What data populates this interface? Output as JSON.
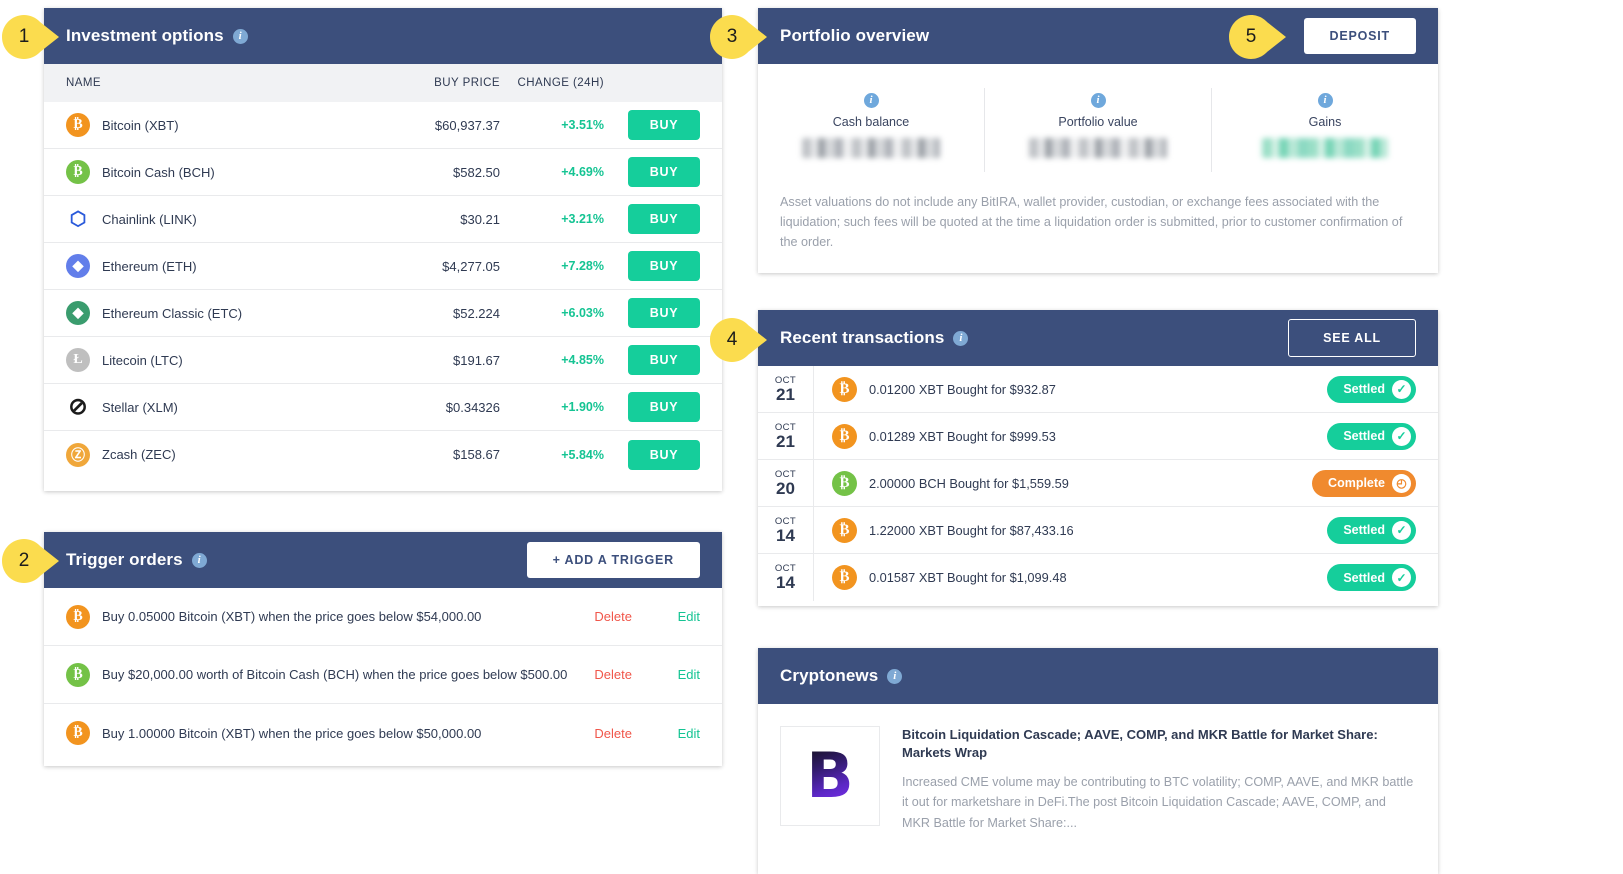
{
  "investment": {
    "title": "Investment options",
    "columns": {
      "name": "NAME",
      "price": "BUY PRICE",
      "change": "CHANGE (24H)"
    },
    "buy_label": "BUY",
    "rows": [
      {
        "name": "Bitcoin (XBT)",
        "price": "$60,937.37",
        "change": "+3.51%",
        "icon": "bitcoin-icon",
        "color": "#f2941f",
        "glyph": "₿"
      },
      {
        "name": "Bitcoin Cash (BCH)",
        "price": "$582.50",
        "change": "+4.69%",
        "icon": "bitcoin-cash-icon",
        "color": "#74c247",
        "glyph": "₿"
      },
      {
        "name": "Chainlink (LINK)",
        "price": "$30.21",
        "change": "+3.21%",
        "icon": "chainlink-icon",
        "color": "#2a5ada",
        "glyph": "⬡"
      },
      {
        "name": "Ethereum (ETH)",
        "price": "$4,277.05",
        "change": "+7.28%",
        "icon": "ethereum-icon",
        "color": "#627eea",
        "glyph": "◆"
      },
      {
        "name": "Ethereum Classic (ETC)",
        "price": "$52.224",
        "change": "+6.03%",
        "icon": "ethereum-classic-icon",
        "color": "#3a9c6e",
        "glyph": "◆"
      },
      {
        "name": "Litecoin (LTC)",
        "price": "$191.67",
        "change": "+4.85%",
        "icon": "litecoin-icon",
        "color": "#bfbfbf",
        "glyph": "Ł"
      },
      {
        "name": "Stellar (XLM)",
        "price": "$0.34326",
        "change": "+1.90%",
        "icon": "stellar-icon",
        "color": "#ffffff",
        "glyph": "⊘"
      },
      {
        "name": "Zcash (ZEC)",
        "price": "$158.67",
        "change": "+5.84%",
        "icon": "zcash-icon",
        "color": "#f0a73a",
        "glyph": "Ⓩ"
      }
    ]
  },
  "triggers": {
    "title": "Trigger orders",
    "add_label": "+ ADD A TRIGGER",
    "delete_label": "Delete",
    "edit_label": "Edit",
    "rows": [
      {
        "text": "Buy 0.05000 Bitcoin (XBT) when the price goes below $54,000.00",
        "icon": "bitcoin-icon",
        "color": "#f2941f",
        "glyph": "₿"
      },
      {
        "text": "Buy $20,000.00 worth of Bitcoin Cash (BCH) when the price goes below $500.00",
        "icon": "bitcoin-cash-icon",
        "color": "#74c247",
        "glyph": "₿"
      },
      {
        "text": "Buy 1.00000 Bitcoin (XBT) when the price goes below $50,000.00",
        "icon": "bitcoin-icon",
        "color": "#f2941f",
        "glyph": "₿"
      }
    ]
  },
  "portfolio": {
    "title": "Portfolio overview",
    "deposit_label": "DEPOSIT",
    "stats": [
      {
        "label": "Cash balance",
        "value": "",
        "redaction": "gray"
      },
      {
        "label": "Portfolio value",
        "value": "",
        "redaction": "gray"
      },
      {
        "label": "Gains",
        "value": "",
        "redaction": "green"
      }
    ],
    "disclaimer": "Asset valuations do not include any BitIRA, wallet provider, custodian, or exchange fees associated with the liquidation; such fees will be quoted at the time a liquidation order is submitted, prior to customer confirmation of the order."
  },
  "transactions": {
    "title": "Recent transactions",
    "see_all_label": "SEE ALL",
    "rows": [
      {
        "month": "OCT",
        "day": "21",
        "text": "0.01200 XBT Bought for $932.87",
        "status": "Settled",
        "status_type": "settled",
        "icon": "bitcoin-icon",
        "color": "#f2941f",
        "glyph": "₿"
      },
      {
        "month": "OCT",
        "day": "21",
        "text": "0.01289 XBT Bought for $999.53",
        "status": "Settled",
        "status_type": "settled",
        "icon": "bitcoin-icon",
        "color": "#f2941f",
        "glyph": "₿"
      },
      {
        "month": "OCT",
        "day": "20",
        "text": "2.00000 BCH Bought for $1,559.59",
        "status": "Complete",
        "status_type": "complete",
        "icon": "bitcoin-cash-icon",
        "color": "#74c247",
        "glyph": "₿"
      },
      {
        "month": "OCT",
        "day": "14",
        "text": "1.22000 XBT Bought for $87,433.16",
        "status": "Settled",
        "status_type": "settled",
        "icon": "bitcoin-icon",
        "color": "#f2941f",
        "glyph": "₿"
      },
      {
        "month": "OCT",
        "day": "14",
        "text": "0.01587 XBT Bought for $1,099.48",
        "status": "Settled",
        "status_type": "settled",
        "icon": "bitcoin-icon",
        "color": "#f2941f",
        "glyph": "₿"
      }
    ]
  },
  "news": {
    "title": "Cryptonews",
    "items": [
      {
        "logo": "B",
        "title": "Bitcoin Liquidation Cascade; AAVE, COMP, and MKR Battle for Market Share: Markets Wrap",
        "description": "Increased CME volume may be contributing to BTC volatility; COMP, AAVE, and MKR battle it out for marketshare in DeFi.The post Bitcoin Liquidation Cascade; AAVE, COMP, and MKR Battle for Market Share:..."
      }
    ]
  },
  "callouts": [
    {
      "number": "1",
      "target": "investment-options-title"
    },
    {
      "number": "2",
      "target": "trigger-orders-title"
    },
    {
      "number": "3",
      "target": "portfolio-overview-title"
    },
    {
      "number": "4",
      "target": "recent-transactions-title"
    },
    {
      "number": "5",
      "target": "deposit-button"
    }
  ],
  "colors": {
    "header_blue": "#3c4f7c",
    "accent_green": "#15ce9b",
    "accent_orange": "#f08a2e",
    "delete_red": "#f0564a",
    "callout_yellow": "#fbdc4e"
  }
}
